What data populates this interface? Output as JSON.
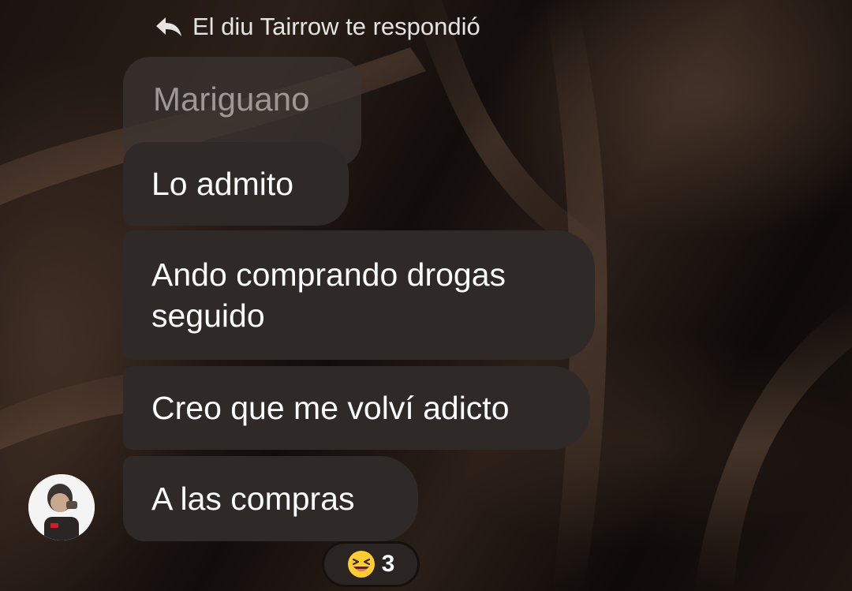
{
  "reply_header": {
    "text": "El diu Tairrow te respondió",
    "icon": "reply-arrow-icon"
  },
  "quoted_message": {
    "text": "Mariguano"
  },
  "messages": [
    {
      "text": "Lo admito"
    },
    {
      "text": "Ando comprando drogas seguido"
    },
    {
      "text": "Creo que me volví adicto"
    },
    {
      "text": "A las compras"
    }
  ],
  "reaction": {
    "emoji": "laughing-face-icon",
    "count": "3"
  },
  "colors": {
    "bubble": "#2f2928",
    "quoted_bubble": "#3a3432",
    "quoted_text": "#9d9896",
    "text": "#ffffff",
    "background": "#1a1310"
  }
}
